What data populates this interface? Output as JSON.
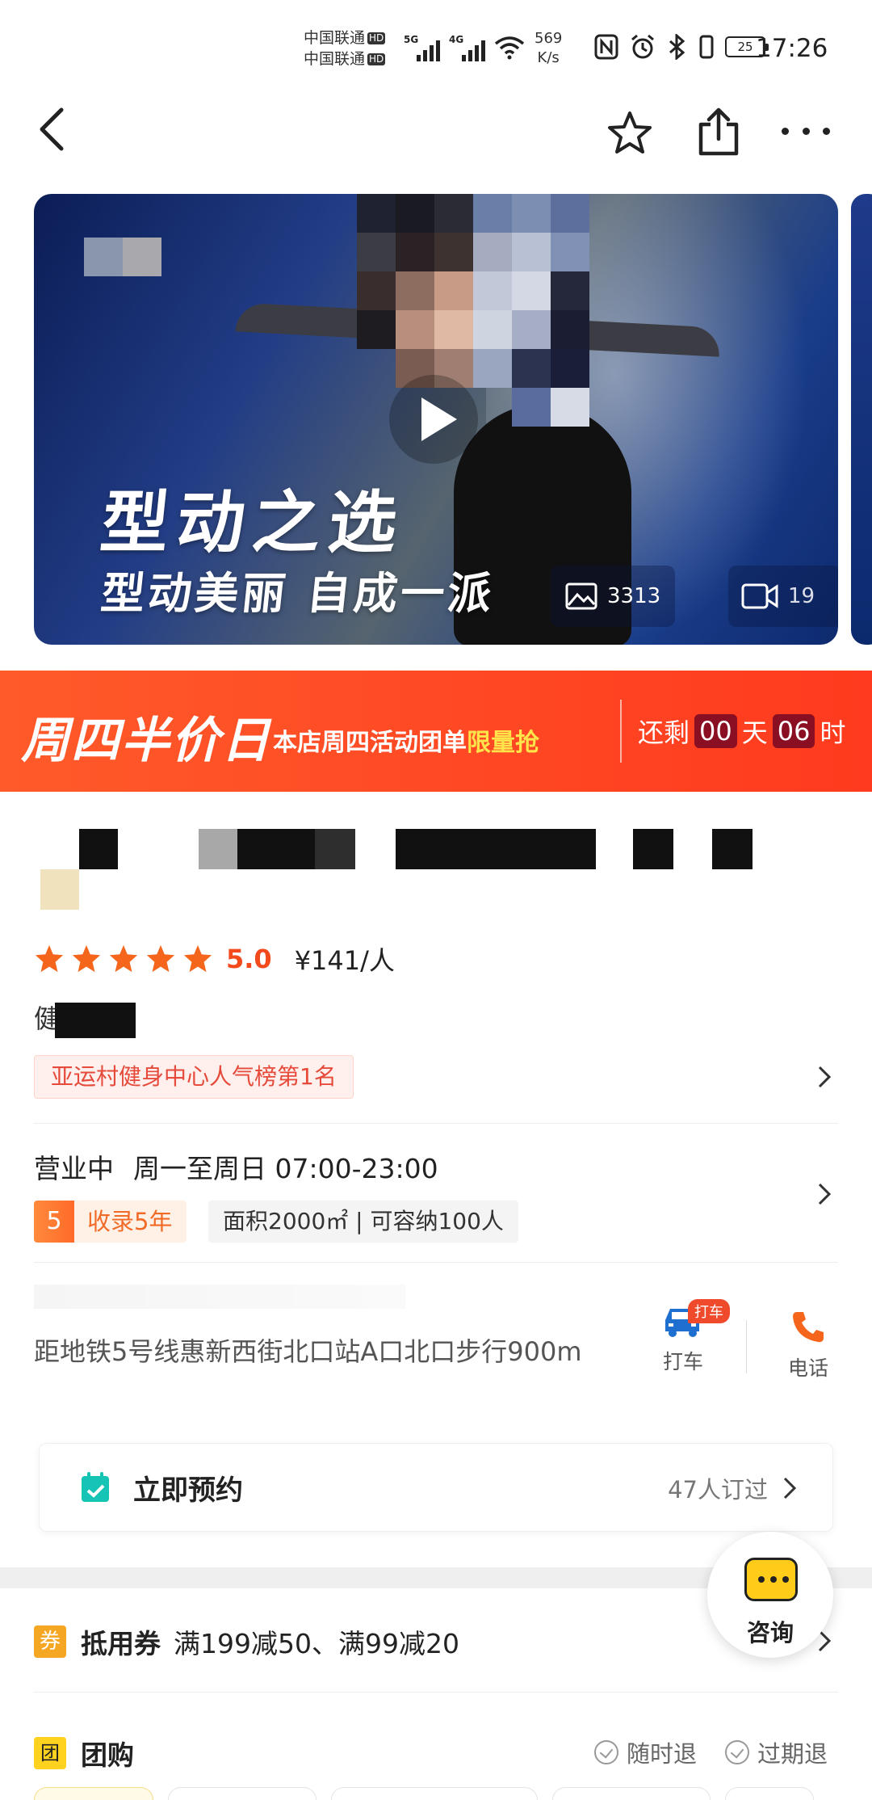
{
  "status_bar": {
    "carrier_line1": "中国联通",
    "carrier_line2": "中国联通",
    "hd_badge": "HD",
    "net_5g": "5G",
    "net_4g": "4G",
    "net_speed_value": "569",
    "net_speed_unit": "K/s",
    "battery": "25",
    "time": "17:26"
  },
  "nav": {
    "back_icon": "chevron-left-icon",
    "favorite_icon": "star-outline-icon",
    "share_icon": "share-icon",
    "more_icon": "more-dots-icon"
  },
  "hero": {
    "title": "型动之选",
    "subtitle": "型动美丽 自成一派",
    "photo_count": "3313",
    "video_count": "19"
  },
  "promo": {
    "title": "周四半价日",
    "desc_prefix": "本店周四活动团单",
    "desc_highlight": "限量抢",
    "countdown_label": "还剩",
    "days_value": "00",
    "days_unit": "天",
    "hours_value": "06",
    "hours_unit": "时"
  },
  "shop": {
    "rating_stars": 5,
    "rating_score": "5.0",
    "price_per_person": "¥141/人",
    "category_prefix": "健",
    "rank_tag": "亚运村健身中心人气榜第1名",
    "status": "营业中",
    "hours": "周一至周日 07:00-23:00",
    "years_num": "5",
    "years_label": "收录5年",
    "facility": "面积2000㎡ | 可容纳100人",
    "address": "距地铁5号线惠新西街北口站A口北口步行900m",
    "taxi_label": "打车",
    "taxi_badge": "打车",
    "phone_label": "电话"
  },
  "booking": {
    "title": "立即预约",
    "meta": "47人订过"
  },
  "consult": {
    "label": "咨询"
  },
  "coupon": {
    "icon_text": "券",
    "title": "抵用券",
    "desc": "满199减50、满99减20"
  },
  "group_buy": {
    "icon_text": "团",
    "title": "团购",
    "refund_anytime": "随时退",
    "refund_expired": "过期退"
  },
  "colors": {
    "accent_orange": "#ff4a24",
    "star_orange": "#f5a623",
    "rating_red": "#f24a1c",
    "countdown_box": "#8a0f22",
    "highlight_yellow": "#ffe34a",
    "taxi_blue": "#1f6fd1"
  }
}
